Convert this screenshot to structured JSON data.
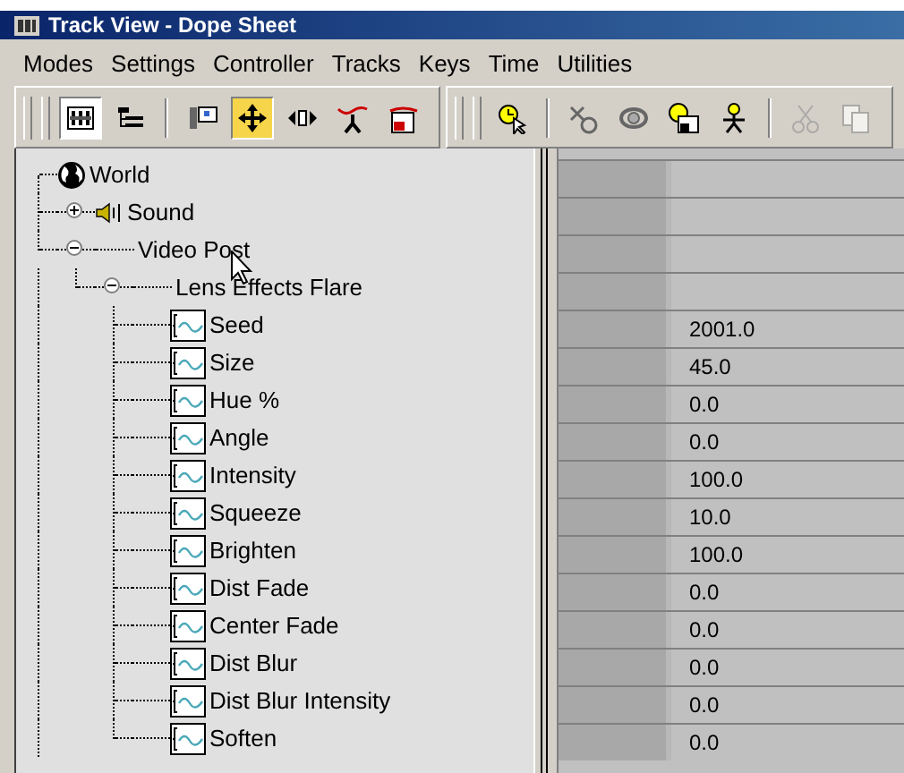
{
  "window": {
    "title": "Track View - Dope Sheet"
  },
  "menu": [
    "Modes",
    "Settings",
    "Controller",
    "Tracks",
    "Keys",
    "Time",
    "Utilities"
  ],
  "toolbars": [
    {
      "groups": [
        [
          {
            "selected": true,
            "disabled": false
          },
          {
            "selected": false,
            "disabled": false
          }
        ],
        [
          {
            "selected": false,
            "disabled": false
          },
          {
            "selected": true,
            "disabled": false
          },
          {
            "selected": false,
            "disabled": false
          },
          {
            "selected": false,
            "disabled": false
          },
          {
            "selected": false,
            "disabled": false
          }
        ]
      ]
    },
    {
      "groups": [
        [
          {
            "selected": false,
            "disabled": false
          }
        ],
        [
          {
            "selected": false,
            "disabled": false
          },
          {
            "selected": false,
            "disabled": false
          },
          {
            "selected": false,
            "disabled": false
          },
          {
            "selected": false,
            "disabled": false
          }
        ],
        [
          {
            "selected": false,
            "disabled": true
          },
          {
            "selected": false,
            "disabled": true
          }
        ]
      ]
    }
  ],
  "tree": [
    {
      "label": "World",
      "kind": "world",
      "children": [
        {
          "label": "Sound",
          "kind": "sound",
          "expanded": false
        },
        {
          "label": "Video Post",
          "kind": "group",
          "expanded": true,
          "children": [
            {
              "label": "Lens Effects Flare",
              "kind": "group",
              "expanded": true,
              "children": [
                {
                  "label": "Seed",
                  "kind": "track",
                  "value": "2001.0"
                },
                {
                  "label": "Size",
                  "kind": "track",
                  "value": "45.0"
                },
                {
                  "label": "Hue %",
                  "kind": "track",
                  "value": "0.0"
                },
                {
                  "label": "Angle",
                  "kind": "track",
                  "value": "0.0"
                },
                {
                  "label": "Intensity",
                  "kind": "track",
                  "value": "100.0"
                },
                {
                  "label": "Squeeze",
                  "kind": "track",
                  "value": "10.0"
                },
                {
                  "label": "Brighten",
                  "kind": "track",
                  "value": "100.0"
                },
                {
                  "label": "Dist Fade",
                  "kind": "track",
                  "value": "0.0"
                },
                {
                  "label": "Center Fade",
                  "kind": "track",
                  "value": "0.0"
                },
                {
                  "label": "Dist Blur",
                  "kind": "track",
                  "value": "0.0"
                },
                {
                  "label": "Dist Blur Intensity",
                  "kind": "track",
                  "value": "0.0"
                },
                {
                  "label": "Soften",
                  "kind": "track",
                  "value": "0.0"
                }
              ]
            }
          ]
        }
      ]
    }
  ]
}
